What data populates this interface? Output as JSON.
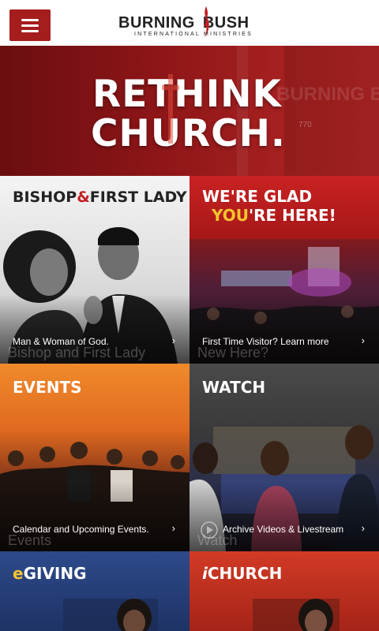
{
  "header": {
    "menu_icon": "hamburger-icon",
    "logo_word_1": "BURNING",
    "logo_word_2": "BUSH",
    "logo_sub": "INTERNATIONAL MINISTRIES",
    "accent": "#a51d1d"
  },
  "hero": {
    "line1": "RETHINK",
    "line2": "CHURCH.",
    "watermark": "BURNING BUSH",
    "number": "770"
  },
  "tiles": [
    {
      "title_a": "BISHOP",
      "title_amp": "&",
      "title_b": "FIRST LADY",
      "caption": "Man & Woman of God.",
      "ghost": "Bishop and First Lady",
      "chevron": "›"
    },
    {
      "title_line1": "WE'RE GLAD",
      "title_you": "YOU",
      "title_rest": "'RE HERE!",
      "caption": "First Time Visitor?  Learn more",
      "ghost": "New Here?",
      "chevron": "›"
    },
    {
      "title": "EVENTS",
      "caption": "Calendar and Upcoming Events.",
      "ghost": "Events",
      "chevron": "›"
    },
    {
      "title": "WATCH",
      "caption": "Archive Videos & Livestream",
      "ghost": "Watch",
      "chevron": "›",
      "icon": "play-icon"
    },
    {
      "title_e": "e",
      "title_rest": "GIVING"
    },
    {
      "title_i": "i",
      "title_rest": "CHURCH"
    }
  ]
}
